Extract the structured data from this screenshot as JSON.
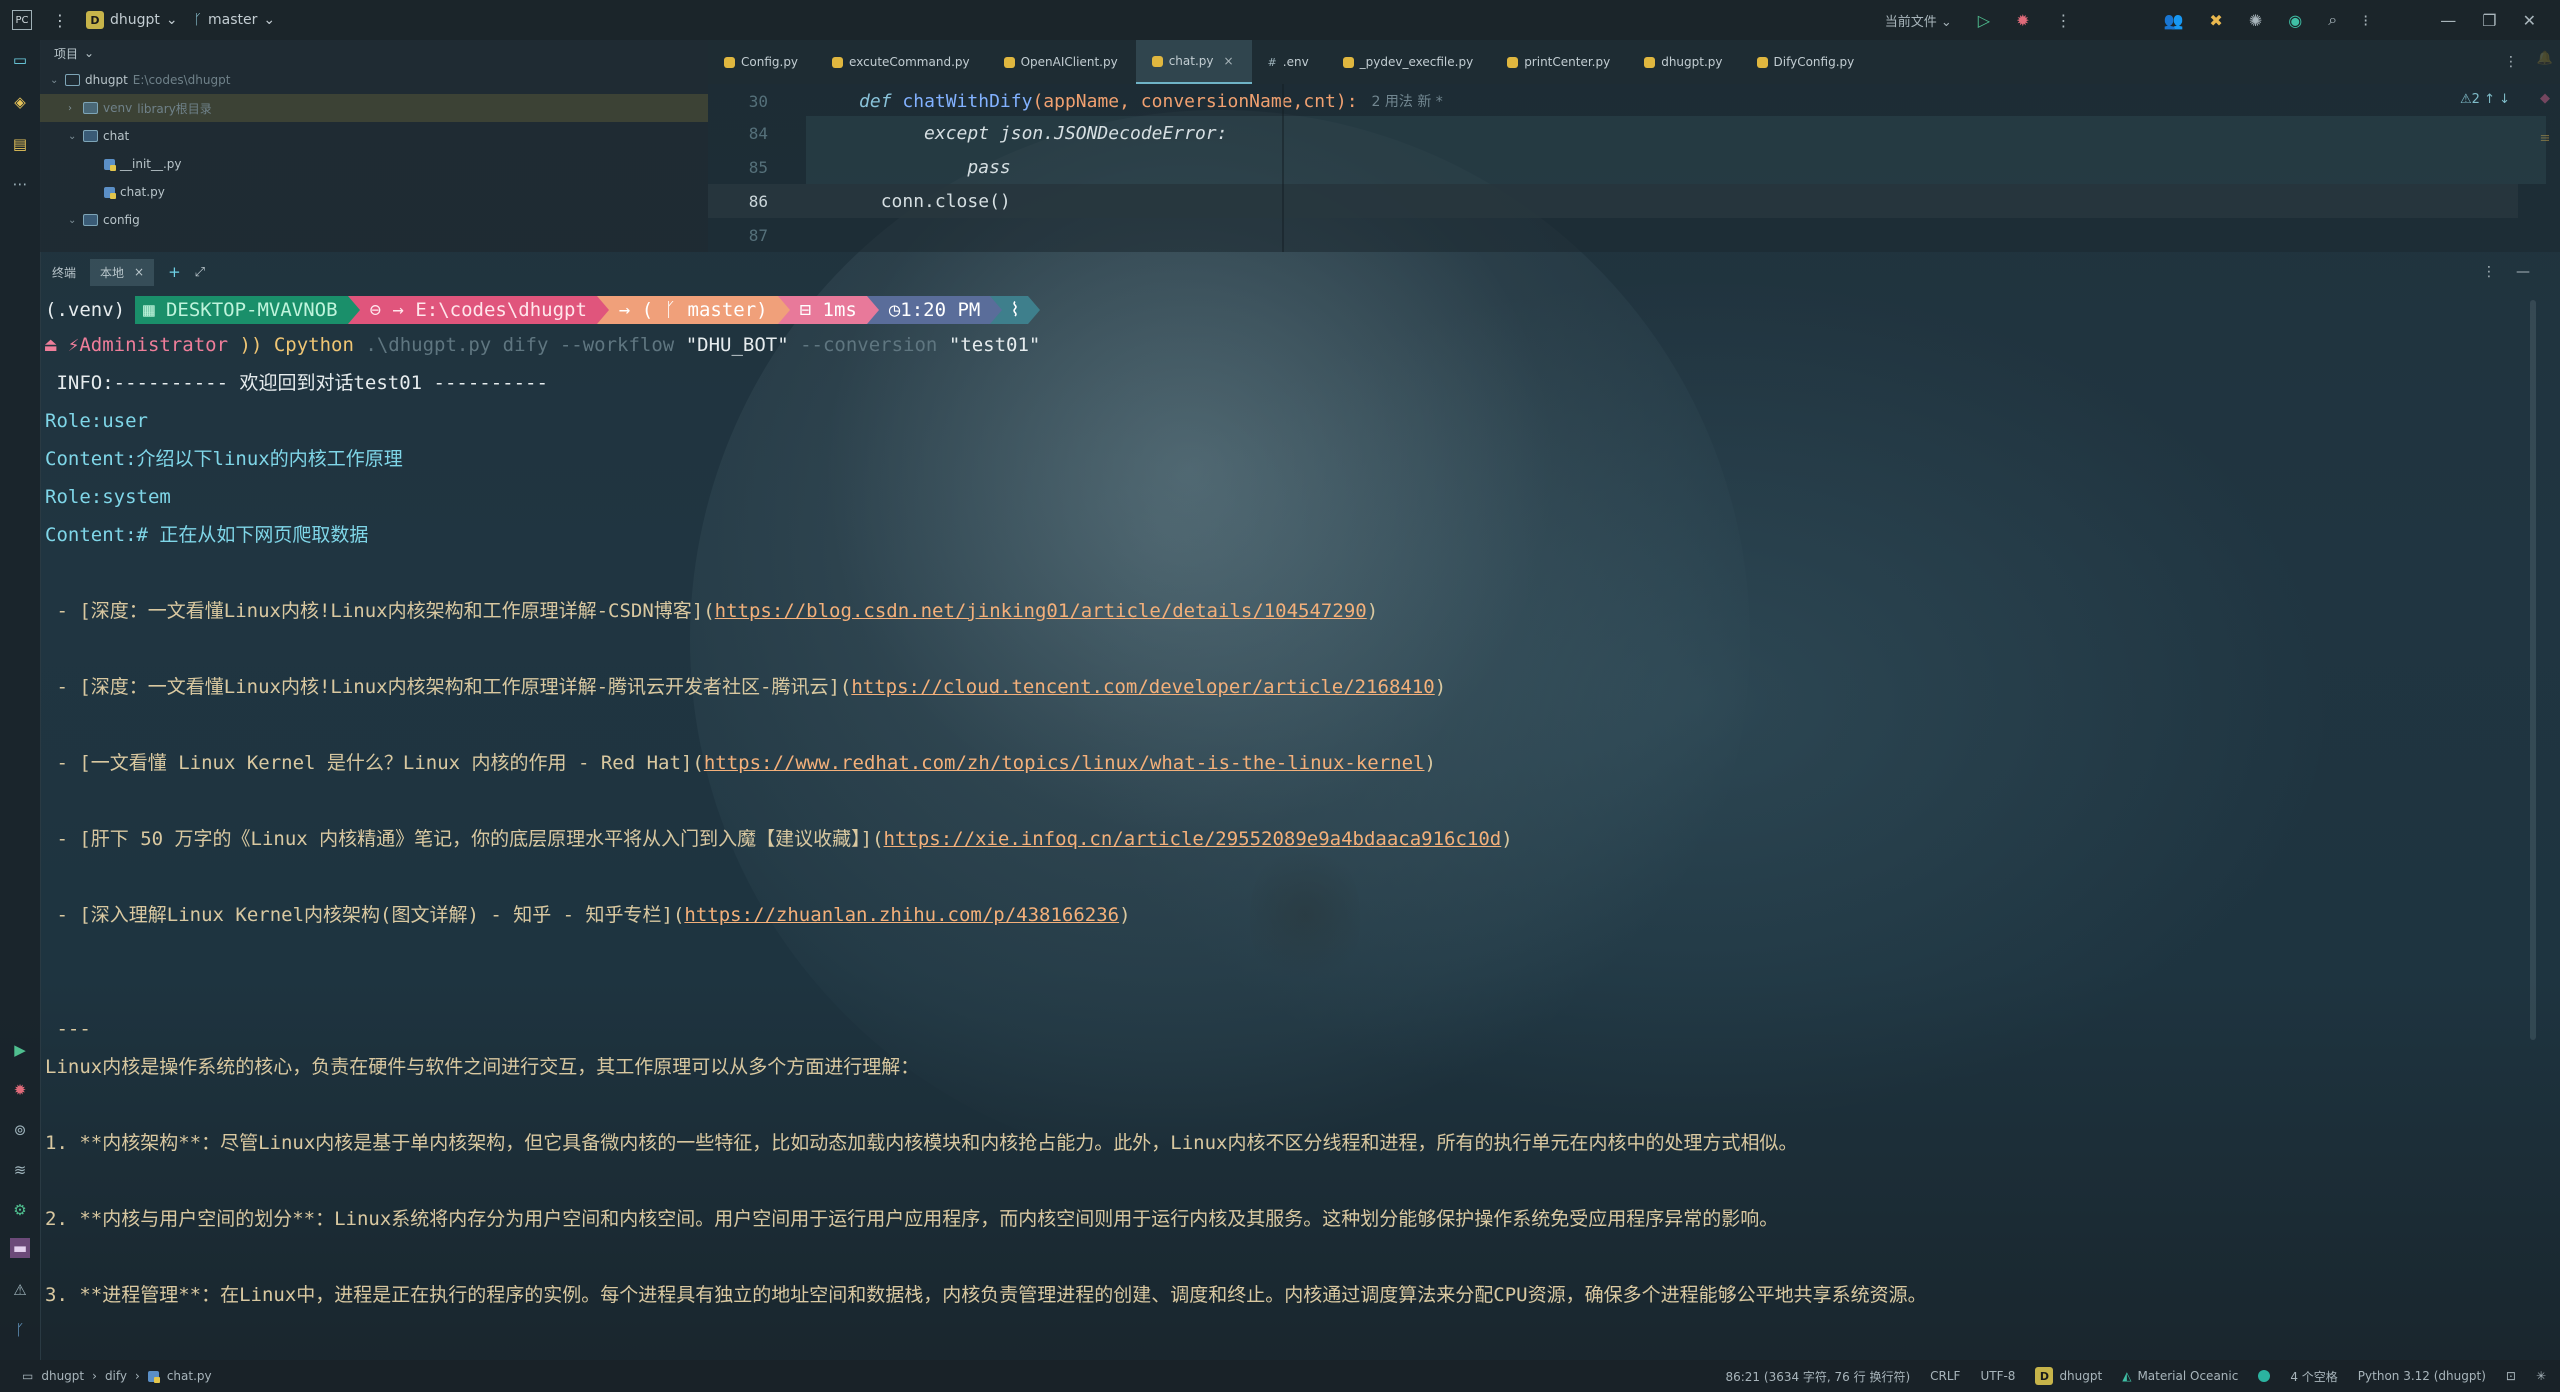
{
  "titlebar": {
    "project_badge": "D",
    "project_name": "dhugpt",
    "branch": "master",
    "run_config": "当前文件"
  },
  "project_panel": {
    "title": "项目",
    "root_name": "dhugpt",
    "root_path": "E:\\codes\\dhugpt",
    "items": [
      {
        "label": "venv",
        "suffix": "library根目录"
      },
      {
        "label": "chat"
      },
      {
        "label": "__init__.py"
      },
      {
        "label": "chat.py"
      },
      {
        "label": "config"
      }
    ]
  },
  "tabs": [
    {
      "label": "Config.py"
    },
    {
      "label": "excuteCommand.py"
    },
    {
      "label": "OpenAIClient.py"
    },
    {
      "label": "chat.py"
    },
    {
      "label": ".env"
    },
    {
      "label": "_pydev_execfile.py"
    },
    {
      "label": "printCenter.py"
    },
    {
      "label": "dhugpt.py"
    },
    {
      "label": "DifyConfig.py"
    }
  ],
  "editor": {
    "header_line_no": "30",
    "header_def": "def",
    "header_func": "chatWithDify",
    "header_params": "(appName, conversionName,cnt):",
    "header_hint": "2 用法   新 *",
    "lines": [
      {
        "no": "84",
        "text": "            except json.JSONDecodeError:"
      },
      {
        "no": "85",
        "text": "                pass"
      },
      {
        "no": "86",
        "text": "        conn.close()"
      },
      {
        "no": "87",
        "text": ""
      }
    ],
    "inspection": "⚠2 ↑ ↓"
  },
  "terminal_tabs": {
    "label": "终端",
    "active_tab": "本地",
    "close": "×",
    "add": "+"
  },
  "terminal": {
    "venv": "(.venv)",
    "host": "DESKTOP-MVAVNOB",
    "path": "E:\\codes\\dhugpt",
    "branch": "master",
    "duration": "1ms",
    "time": "1:20 PM",
    "user": "⚡Administrator",
    "prompt_sym": "))",
    "cmd": "Cpython",
    "cmd_args_1": ".\\dhugpt.py dify --workflow",
    "cmd_str_1": "\"DHU_BOT\"",
    "cmd_args_2": "--conversion",
    "cmd_str_2": "\"test01\"",
    "info": " INFO:---------- 欢迎回到对话test01 ----------",
    "role_user": "Role:user",
    "content_user": "Content:介绍以下linux的内核工作原理",
    "role_system": "Role:system",
    "content_system": "Content:# 正在从如下网页爬取数据",
    "links": [
      {
        "text": " - [深度：一文看懂Linux内核!Linux内核架构和工作原理详解-CSDN博客](",
        "url": "https://blog.csdn.net/jinking01/article/details/104547290",
        "close": ")"
      },
      {
        "text": " - [深度：一文看懂Linux内核!Linux内核架构和工作原理详解-腾讯云开发者社区-腾讯云](",
        "url": "https://cloud.tencent.com/developer/article/2168410",
        "close": ")"
      },
      {
        "text": " - [一文看懂 Linux Kernel 是什么？Linux 内核的作用 - Red Hat](",
        "url": "https://www.redhat.com/zh/topics/linux/what-is-the-linux-kernel",
        "close": ")"
      },
      {
        "text": " - [肝下 50 万字的《Linux 内核精通》笔记，你的底层原理水平将从入门到入魔【建议收藏】](",
        "url": "https://xie.infoq.cn/article/29552089e9a4bdaaca916c10d",
        "close": ")"
      },
      {
        "text": " - [深入理解Linux Kernel内核架构(图文详解) - 知乎 - 知乎专栏](",
        "url": "https://zhuanlan.zhihu.com/p/438166236",
        "close": ")"
      }
    ],
    "separator": " ---",
    "intro": "Linux内核是操作系统的核心，负责在硬件与软件之间进行交互，其工作原理可以从多个方面进行理解：",
    "points": [
      "1. **内核架构**：尽管Linux内核是基于单内核架构，但它具备微内核的一些特征，比如动态加载内核模块和内核抢占能力。此外，Linux内核不区分线程和进程，所有的执行单元在内核中的处理方式相似。",
      "2. **内核与用户空间的划分**：Linux系统将内存分为用户空间和内核空间。用户空间用于运行用户应用程序，而内核空间则用于运行内核及其服务。这种划分能够保护操作系统免受应用程序异常的影响。",
      "3. **进程管理**：在Linux中，进程是正在执行的程序的实例。每个进程具有独立的地址空间和数据栈，内核负责管理进程的创建、调度和终止。内核通过调度算法来分配CPU资源，确保多个进程能够公平地共享系统资源。"
    ]
  },
  "statusbar": {
    "crumbs": [
      "dhugpt",
      "dify",
      "chat.py"
    ],
    "position": "86:21 (3634 字符, 76 行 换行符)",
    "line_sep": "CRLF",
    "encoding": "UTF-8",
    "project_badge": "D",
    "project": "dhugpt",
    "theme": "Material Oceanic",
    "indent": "4 个空格",
    "interpreter": "Python 3.12 (dhugpt)"
  },
  "colors": {
    "accent": "#6fb3c6",
    "link": "#f4b07a",
    "prompt_green": "#1f9f6e",
    "prompt_pink": "#e8527a"
  }
}
